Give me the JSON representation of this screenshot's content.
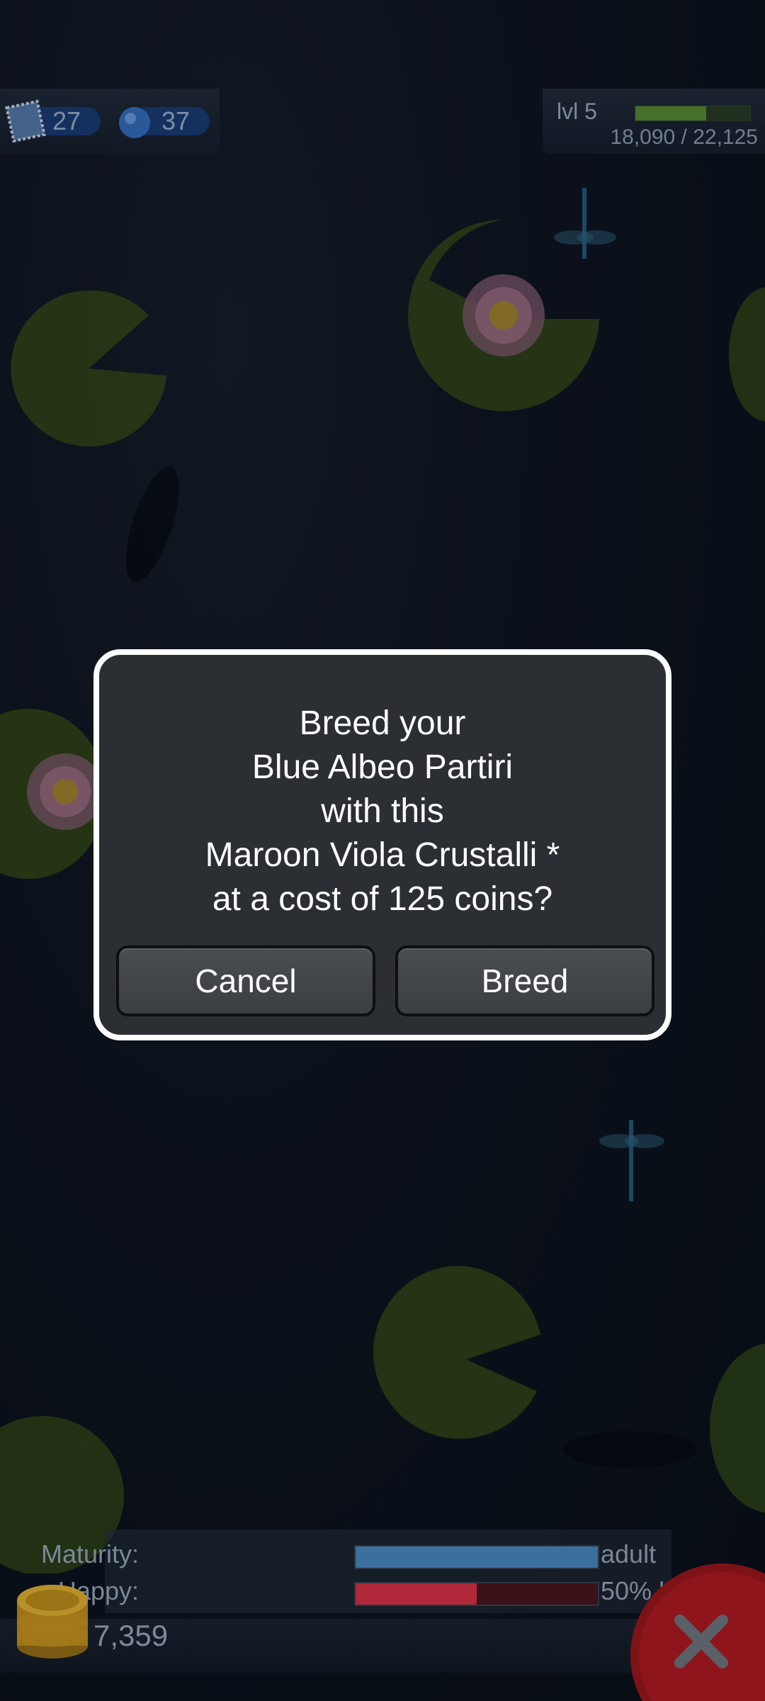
{
  "hud": {
    "stamps": "27",
    "gems": "37",
    "level": "lvl 5",
    "xp_text": "18,090 / 22,125",
    "xp_progress": 0.62
  },
  "dialog": {
    "lines": [
      "Breed your",
      "Blue Albeo Partiri",
      "with this",
      "Maroon Viola Crustalli *",
      "at a cost of 125 coins?"
    ],
    "cancel_label": "Cancel",
    "breed_label": "Breed"
  },
  "status": {
    "maturity_label": "Maturity:",
    "maturity_value": "adult",
    "maturity_progress": 1.0,
    "happy_label": "Happy:",
    "happy_value": "50% happy",
    "happy_progress": 0.5,
    "coins": "7,359"
  },
  "colors": {
    "maturity_fill": "#3a6f9e",
    "happy_fill": "#b0283a",
    "close_button": "#a8121b"
  },
  "icons": [
    "stamp-icon",
    "gem-icon",
    "coin-stack-icon",
    "close-icon"
  ]
}
